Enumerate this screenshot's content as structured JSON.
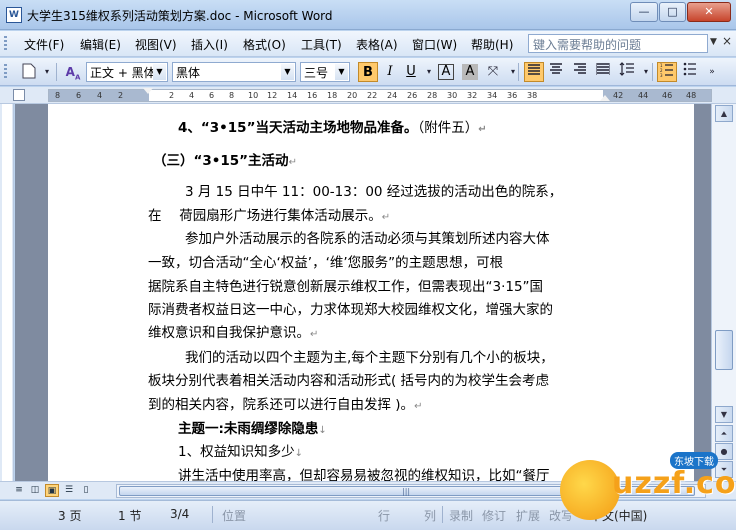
{
  "window": {
    "app_icon": "W",
    "title": "大学生315维权系列活动策划方案.doc - Microsoft Word",
    "minimize": "—",
    "maximize": "□",
    "close": "✕"
  },
  "menu": {
    "items": [
      "文件(F)",
      "编辑(E)",
      "视图(V)",
      "插入(I)",
      "格式(O)",
      "工具(T)",
      "表格(A)",
      "窗口(W)",
      "帮助(H)"
    ],
    "help_placeholder": "键入需要帮助的问题",
    "help_arrow": "▼",
    "close_doc": "×"
  },
  "toolbar": {
    "style_value": "正文 + 黑体",
    "font_value": "黑体",
    "size_value": "三号",
    "bold": "B",
    "italic": "I",
    "underline": "U",
    "char_border": "A",
    "char_shading": "A",
    "active_color": "#ffc96b"
  },
  "ruler": {
    "numbers": [
      "8",
      "6",
      "4",
      "2",
      "",
      "2",
      "4",
      "6",
      "8",
      "10",
      "12",
      "14",
      "16",
      "18",
      "20",
      "22",
      "24",
      "26",
      "28",
      "30",
      "32",
      "34",
      "36",
      "38",
      "",
      "42",
      "44",
      "46",
      "48"
    ]
  },
  "document": {
    "lines": [
      "4、“3•15”当天活动主场地物品准备。",
      "（附件五）",
      "（三）“3•15”主活动",
      "3 月 15 日中午 11：00-13：00 经过选拔的活动出色的院系，",
      "在　 荷园扇形广场进行集体活动展示。",
      "参加户外活动展示的各院系的活动必须与其策划所述内容大体",
      "一致，切合活动“全心‘权益’，‘维’您服务”的主题思想，可根",
      "据院系自主特色进行锐意创新展示维权工作，但需表现出“3·15”国",
      "际消费者权益日这一中心，力求体现郑大校园维权文化，增强大家的",
      "维权意识和自我保护意识。",
      "我们的活动以四个主题为主,每个主题下分别有几个小的板块，",
      "板块分别代表着相关活动内容和活动形式( 括号内的为校学生会考虑",
      "到的相关内容，院系还可以进行自由发挥 )。",
      "主题一:未雨绸缪除隐患",
      "1、权益知识知多少",
      "讲生活中使用率高，但却容易易被忽视的维权知识，比如“餐厅"
    ],
    "para_mark": "↵",
    "arrow_mark": "↓"
  },
  "status": {
    "page": "3 页",
    "section": "1 节",
    "page_of": "3/4",
    "position": "位置",
    "line": "行",
    "column": "列",
    "record": "录制",
    "revise": "修订",
    "extend": "扩展",
    "overwrite": "改写",
    "language": "中文(中国)"
  },
  "watermark": {
    "text": "uzzf.com",
    "tag": "东坡下载"
  }
}
